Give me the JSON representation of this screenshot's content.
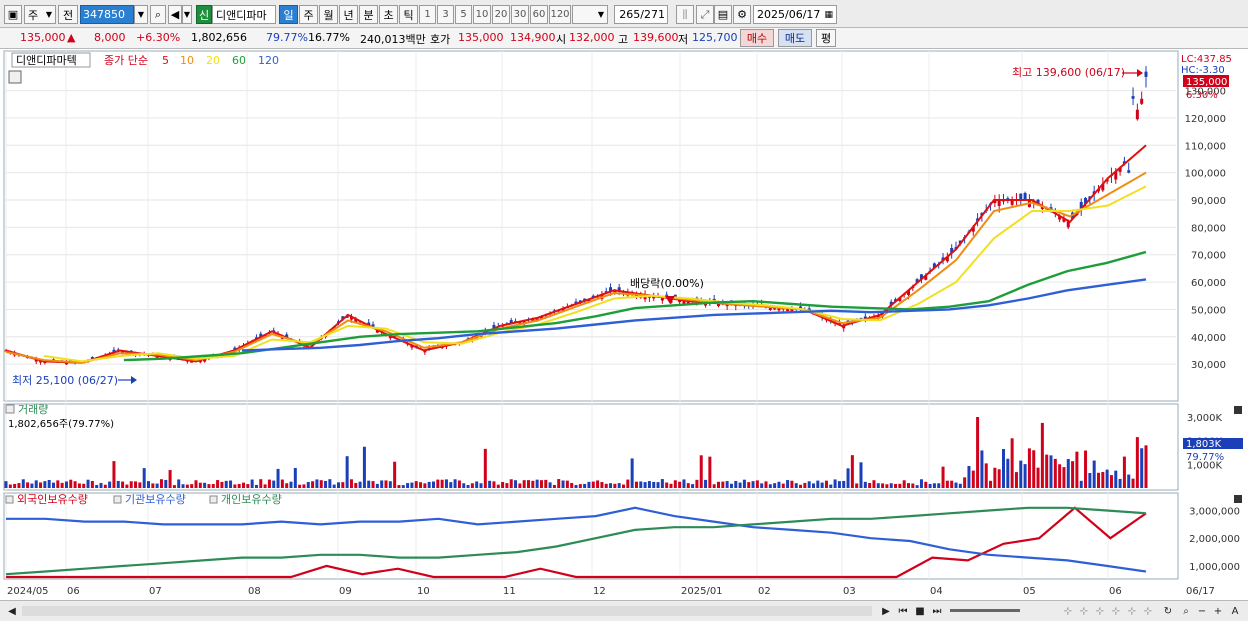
{
  "toolbar": {
    "mode_label": "주",
    "prev_label": "전",
    "stock_code": "347850",
    "new_badge": "신",
    "stock_name": "디앤디파마",
    "periods": [
      "일",
      "주",
      "월",
      "년",
      "분",
      "초",
      "틱"
    ],
    "minute_options": [
      "1",
      "3",
      "5",
      "10",
      "20",
      "30",
      "60",
      "120"
    ],
    "record_counter": "265",
    "record_total": "/271",
    "date_value": "2025/06/17"
  },
  "quote": {
    "price": "135,000",
    "change_arrow": "▲",
    "change": "8,000",
    "change_pct": "+6.30%",
    "volume": "1,802,656",
    "volume_ratio": "79.77%",
    "turnover": "16.77%",
    "amount": "240,013백만",
    "ask_label": "호가",
    "ask": "135,000",
    "bid": "134,900",
    "open_label": "시",
    "open": "132,000",
    "high_label": "고",
    "high": "139,600",
    "low_label": "저",
    "low": "125,700",
    "buy_label": "매수",
    "sell_label": "매도",
    "eval_label": "평"
  },
  "price_panel": {
    "legend_name": "디앤디파마텍",
    "legend_ma_label": "종가 단순",
    "ma_periods": [
      "5",
      "10",
      "20",
      "60",
      "120"
    ],
    "ma_colors": [
      "#e01010",
      "#f08c10",
      "#f0e020",
      "#1e9e3a",
      "#2f5fd6"
    ],
    "lc_label": "LC:437.85",
    "hc_label": "HC:-3.30",
    "last_price_tag": "135,000",
    "last_pct_tag": "6.30%",
    "high_annotation": "최고 139,600 (06/17)",
    "low_annotation": "최저 25,100 (06/27)",
    "dividend_annotation": "배당락(0.00%)",
    "y_ticks": [
      "130,000",
      "120,000",
      "110,000",
      "100,000",
      "90,000",
      "80,000",
      "70,000",
      "60,000",
      "50,000",
      "40,000",
      "30,000"
    ]
  },
  "volume_panel": {
    "title": "거래량",
    "subtitle": "1,802,656주(79.77%)",
    "y_ticks": [
      "3,000K",
      "2,000K",
      "1,000K"
    ],
    "last_tag": "1,803K",
    "pct_tag": "79.77%"
  },
  "holding_panel": {
    "legend": [
      "외국인보유수량",
      "기관보유수량",
      "개인보유수량"
    ],
    "y_ticks": [
      "3,000,000",
      "2,000,000",
      "1,000,000"
    ]
  },
  "x_axis": {
    "labels": [
      "2024/05",
      "06",
      "07",
      "08",
      "09",
      "10",
      "11",
      "12",
      "2025/01",
      "02",
      "03",
      "04",
      "05",
      "06"
    ],
    "right_label": "06/17"
  },
  "colors": {
    "up": "#d0021b",
    "down": "#1a3fb8",
    "foreign": "#d0021b",
    "institution": "#2f5fd6",
    "individual": "#2e8b57"
  },
  "chart_data": {
    "type": "candlestick",
    "x_range": [
      "2024/05",
      "2025/06/17"
    ],
    "ylim": [
      25000,
      140000
    ],
    "ma_series": [
      {
        "name": "5",
        "values": [
          35000,
          31000,
          30500,
          35000,
          33000,
          31000,
          35000,
          42000,
          36000,
          48000,
          41000,
          35000,
          38000,
          44000,
          47000,
          52000,
          57000,
          55000,
          53000,
          52000,
          51000,
          50000,
          44000,
          48000,
          60000,
          72000,
          90000,
          90000,
          82000,
          98000,
          110000
        ]
      },
      {
        "name": "10",
        "values": [
          34500,
          31500,
          30500,
          34000,
          33500,
          31500,
          34500,
          41000,
          37000,
          46000,
          42000,
          36000,
          38000,
          43000,
          46000,
          51000,
          56000,
          55000,
          53500,
          52000,
          51000,
          50000,
          45000,
          47000,
          57000,
          68000,
          86000,
          89000,
          84000,
          92000,
          100000
        ]
      },
      {
        "name": "20",
        "values": [
          null,
          33000,
          31000,
          33000,
          34000,
          32000,
          33000,
          39000,
          38000,
          44000,
          43000,
          38000,
          37500,
          41500,
          44500,
          49000,
          54000,
          55000,
          54000,
          52500,
          51500,
          50000,
          46500,
          46000,
          52000,
          60000,
          76000,
          86000,
          86000,
          88000,
          95000
        ]
      },
      {
        "name": "60",
        "values": [
          null,
          null,
          null,
          31500,
          32000,
          33000,
          34000,
          36000,
          38000,
          40000,
          41000,
          41500,
          42000,
          43500,
          45000,
          47500,
          50500,
          51500,
          52500,
          53000,
          52000,
          51000,
          50500,
          50000,
          51000,
          53000,
          59000,
          64000,
          67000,
          71000
        ]
      },
      {
        "name": "120",
        "values": [
          null,
          null,
          null,
          null,
          null,
          null,
          35000,
          35500,
          36000,
          37000,
          38500,
          39500,
          41000,
          42000,
          43000,
          44500,
          46000,
          47000,
          48000,
          48500,
          49000,
          49500,
          49000,
          49500,
          50000,
          51500,
          54000,
          57000,
          59000,
          61000
        ]
      }
    ],
    "volume_peak_k": 3000,
    "last_volume_k": 1803,
    "holding_series": [
      {
        "name": "외국인보유수량",
        "values": [
          0.6,
          0.6,
          0.6,
          0.6,
          0.6,
          0.6,
          0.6,
          0.6,
          0.6,
          1.0,
          0.7,
          0.9,
          0.6,
          0.6,
          0.6,
          0.9,
          0.6,
          0.6,
          0.6,
          0.6,
          0.6,
          0.6,
          0.6,
          0.6,
          0.6,
          0.6,
          1.3,
          1.2,
          1.8,
          2.0,
          3.1,
          2.0,
          2.9
        ]
      },
      {
        "name": "기관보유수량",
        "values": [
          2.7,
          2.7,
          2.6,
          2.6,
          2.5,
          2.5,
          2.5,
          2.6,
          2.5,
          2.6,
          2.6,
          2.7,
          2.5,
          2.6,
          2.7,
          2.8,
          3.1,
          2.8,
          2.6,
          2.4,
          2.3,
          2.2,
          2.0,
          1.9,
          1.6,
          1.4,
          1.3,
          1.2,
          1.0,
          0.8
        ]
      },
      {
        "name": "개인보유수량",
        "values": [
          0.7,
          0.8,
          0.9,
          1.0,
          1.1,
          1.2,
          1.3,
          1.3,
          1.4,
          1.4,
          1.3,
          1.3,
          1.4,
          1.5,
          1.7,
          2.0,
          2.3,
          2.4,
          2.4,
          2.5,
          2.6,
          2.7,
          2.7,
          2.8,
          2.9,
          3.0,
          3.1,
          3.1,
          3.0,
          2.9
        ]
      }
    ]
  }
}
